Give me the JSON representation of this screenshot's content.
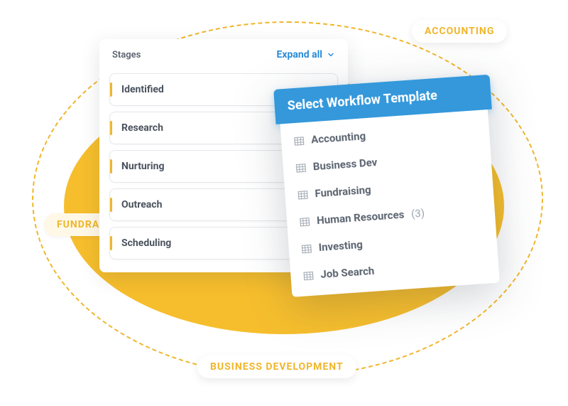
{
  "stages": {
    "title": "Stages",
    "expand_label": "Expand all",
    "items": [
      {
        "label": "Identified"
      },
      {
        "label": "Research"
      },
      {
        "label": "Nurturing"
      },
      {
        "label": "Outreach"
      },
      {
        "label": "Scheduling"
      }
    ]
  },
  "workflow_dropdown": {
    "title": "Select Workflow Template",
    "items": [
      {
        "label": "Accounting",
        "count": ""
      },
      {
        "label": "Business Dev",
        "count": ""
      },
      {
        "label": "Fundraising",
        "count": ""
      },
      {
        "label": "Human Resources",
        "count": "(3)"
      },
      {
        "label": "Investing",
        "count": ""
      },
      {
        "label": "Job Search",
        "count": ""
      }
    ]
  },
  "tags": {
    "accounting": "ACCOUNTING",
    "fundraising": "FUNDRASING",
    "business_dev": "BUSINESS DEVELOPMENT"
  },
  "colors": {
    "accent_yellow": "#f6be2d",
    "accent_blue": "#3498db",
    "text_muted": "#5b6470"
  }
}
